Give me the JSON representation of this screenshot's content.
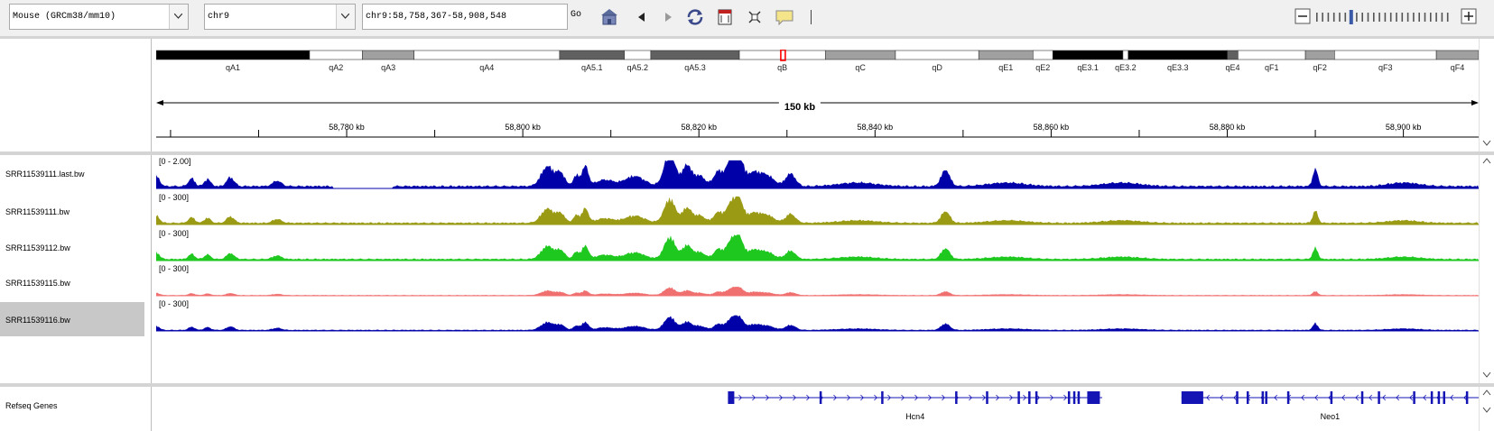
{
  "toolbar": {
    "genome_value": "Mouse (GRCm38/mm10)",
    "chromosome_value": "chr9",
    "locus_value": "chr9:58,758,367-58,908,548",
    "go_label": "Go",
    "icons": [
      "home-icon",
      "back-icon",
      "forward-icon",
      "refresh-icon",
      "ruler-icon",
      "fit-icon",
      "popup-icon"
    ]
  },
  "ideogram": {
    "bands": [
      {
        "name": "qA1",
        "start": 0,
        "end": 0.116,
        "stain": "#000000"
      },
      {
        "name": "qA2",
        "start": 0.116,
        "end": 0.156,
        "stain": "#ffffff"
      },
      {
        "name": "qA3",
        "start": 0.156,
        "end": 0.195,
        "stain": "#a0a0a0"
      },
      {
        "name": "qA4",
        "start": 0.195,
        "end": 0.305,
        "stain": "#ffffff"
      },
      {
        "name": "qA5.1",
        "start": 0.305,
        "end": 0.354,
        "stain": "#606060"
      },
      {
        "name": "qA5.2",
        "start": 0.354,
        "end": 0.374,
        "stain": "#ffffff"
      },
      {
        "name": "qA5.3",
        "start": 0.374,
        "end": 0.441,
        "stain": "#606060"
      },
      {
        "name": "qB",
        "start": 0.441,
        "end": 0.506,
        "stain": "#ffffff"
      },
      {
        "name": "qC",
        "start": 0.506,
        "end": 0.559,
        "stain": "#a0a0a0"
      },
      {
        "name": "qD",
        "start": 0.559,
        "end": 0.622,
        "stain": "#ffffff"
      },
      {
        "name": "qE1",
        "start": 0.622,
        "end": 0.663,
        "stain": "#a0a0a0"
      },
      {
        "name": "qE2",
        "start": 0.663,
        "end": 0.678,
        "stain": "#ffffff"
      },
      {
        "name": "qE3.1",
        "start": 0.678,
        "end": 0.731,
        "stain": "#000000"
      },
      {
        "name": "qE3.2",
        "start": 0.731,
        "end": 0.735,
        "stain": "#ffffff"
      },
      {
        "name": "qE3.3",
        "start": 0.735,
        "end": 0.81,
        "stain": "#000000"
      },
      {
        "name": "qE4",
        "start": 0.81,
        "end": 0.818,
        "stain": "#606060"
      },
      {
        "name": "qF1",
        "start": 0.818,
        "end": 0.869,
        "stain": "#ffffff"
      },
      {
        "name": "qF2",
        "start": 0.869,
        "end": 0.891,
        "stain": "#a0a0a0"
      },
      {
        "name": "qF3",
        "start": 0.891,
        "end": 0.968,
        "stain": "#ffffff"
      },
      {
        "name": "qF4",
        "start": 0.968,
        "end": 1.0,
        "stain": "#a0a0a0"
      }
    ],
    "current_view": 0.474
  },
  "ruler": {
    "span_label": "150 kb",
    "view_start": 58758367,
    "view_end": 58908548,
    "ticks": [
      {
        "pos": 58780000,
        "label": "58,780 kb"
      },
      {
        "pos": 58800000,
        "label": "58,800 kb"
      },
      {
        "pos": 58820000,
        "label": "58,820 kb"
      },
      {
        "pos": 58840000,
        "label": "58,840 kb"
      },
      {
        "pos": 58860000,
        "label": "58,860 kb"
      },
      {
        "pos": 58880000,
        "label": "58,880 kb"
      },
      {
        "pos": 58900000,
        "label": "58,900 kb"
      }
    ]
  },
  "tracks": [
    {
      "name": "SRR11539111.last.bw",
      "range": "[0 - 2.00]",
      "color": "#0000a8",
      "scale": 1.0,
      "selected": false
    },
    {
      "name": "SRR11539111.bw",
      "range": "[0 - 300]",
      "color": "#9a9a14",
      "scale": 1.0,
      "selected": false
    },
    {
      "name": "SRR11539112.bw",
      "range": "[0 - 300]",
      "color": "#1ec81e",
      "scale": 0.92,
      "selected": false
    },
    {
      "name": "SRR11539115.bw",
      "range": "[0 - 300]",
      "color": "#f07070",
      "scale": 0.32,
      "selected": false
    },
    {
      "name": "SRR11539116.bw",
      "range": "[0 - 300]",
      "color": "#0000a8",
      "scale": 0.55,
      "selected": true
    }
  ],
  "genes_track": {
    "name": "Refseq Genes",
    "color": "#1414b4",
    "genes": [
      {
        "name": "Hcn4",
        "start": 58823300,
        "end": 58865800,
        "strand": "+",
        "exons": [
          58823300,
          58833700,
          58840700,
          58849100,
          58852600,
          58856200,
          58857400,
          58858200,
          58861900,
          58862500,
          58863000,
          58864100
        ]
      },
      {
        "name": "Neo1",
        "start": 58874800,
        "end": 58908548,
        "strand": "-",
        "exons": [
          58874800,
          58875400,
          58877000,
          58881000,
          58882200,
          58883900,
          58884300,
          58886800,
          58891700,
          58895200,
          58897100,
          58901100,
          58903100,
          58903900,
          58904500,
          58907100
        ]
      }
    ]
  },
  "signal_peaks": [
    {
      "pos": 58758400,
      "h": 0.28,
      "w": 500
    },
    {
      "pos": 58762400,
      "h": 0.22,
      "w": 500
    },
    {
      "pos": 58764200,
      "h": 0.2,
      "w": 500
    },
    {
      "pos": 58766800,
      "h": 0.25,
      "w": 600
    },
    {
      "pos": 58772100,
      "h": 0.15,
      "w": 700
    },
    {
      "pos": 58802800,
      "h": 0.55,
      "w": 1000
    },
    {
      "pos": 58804300,
      "h": 0.35,
      "w": 700
    },
    {
      "pos": 58806100,
      "h": 0.3,
      "w": 500
    },
    {
      "pos": 58807100,
      "h": 0.55,
      "w": 500
    },
    {
      "pos": 58809300,
      "h": 0.18,
      "w": 1400
    },
    {
      "pos": 58812700,
      "h": 0.28,
      "w": 1600
    },
    {
      "pos": 58816700,
      "h": 0.92,
      "w": 900
    },
    {
      "pos": 58818600,
      "h": 0.55,
      "w": 700
    },
    {
      "pos": 58820000,
      "h": 0.3,
      "w": 1000
    },
    {
      "pos": 58822200,
      "h": 0.42,
      "w": 700
    },
    {
      "pos": 58823500,
      "h": 0.58,
      "w": 700
    },
    {
      "pos": 58824400,
      "h": 1.0,
      "w": 700
    },
    {
      "pos": 58826300,
      "h": 0.4,
      "w": 1400
    },
    {
      "pos": 58828000,
      "h": 0.2,
      "w": 1000
    },
    {
      "pos": 58830400,
      "h": 0.35,
      "w": 800
    },
    {
      "pos": 58838000,
      "h": 0.1,
      "w": 3000
    },
    {
      "pos": 58848000,
      "h": 0.45,
      "w": 700
    },
    {
      "pos": 58855000,
      "h": 0.1,
      "w": 3000
    },
    {
      "pos": 58868000,
      "h": 0.1,
      "w": 3000
    },
    {
      "pos": 58890000,
      "h": 0.48,
      "w": 400
    },
    {
      "pos": 58900000,
      "h": 0.1,
      "w": 2500
    }
  ]
}
